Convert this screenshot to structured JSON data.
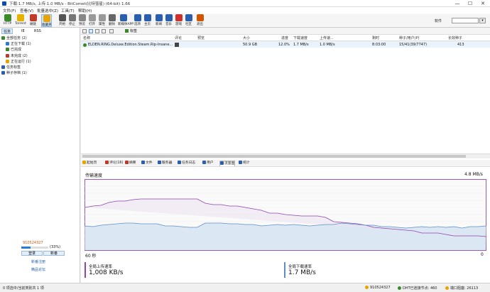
{
  "window": {
    "title": "下载:1.7 MB/s, 上传:1.0 MB/s - BitComet(比特彗星) (64-bit) 1.66",
    "controls": [
      "—",
      "☐",
      "✕"
    ]
  },
  "menu": [
    "文件(F)",
    "查看(V)",
    "批量选中(Z)",
    "工具(T)",
    "帮助(H)"
  ],
  "toolbar": {
    "buttons": [
      {
        "label": "HTTP",
        "icon": "http-icon",
        "color": "#3a8a2a"
      },
      {
        "label": "Torrent",
        "icon": "torrent-icon",
        "color": "#e5b200"
      },
      {
        "label": "磁链",
        "icon": "magnet-icon",
        "color": "#c0392b"
      },
      {
        "label": "收藏夹",
        "icon": "favorites-icon",
        "color": "#e8a400"
      },
      {
        "label": "开始",
        "icon": "start-icon",
        "color": "#555"
      },
      {
        "label": "停止",
        "icon": "stop-icon",
        "color": "#777"
      },
      {
        "label": "预览",
        "icon": "preview-icon",
        "color": "#888"
      },
      {
        "label": "打开",
        "icon": "open-icon",
        "color": "#999"
      },
      {
        "label": "属性",
        "icon": "properties-icon",
        "color": "#999"
      },
      {
        "label": "删除",
        "icon": "delete-icon",
        "color": "#666"
      },
      {
        "label": "新媒体APP",
        "icon": "app-icon",
        "color": "#2a5fb0"
      },
      {
        "label": "选项",
        "icon": "options-icon",
        "color": "#2a5fb0"
      },
      {
        "label": "主页",
        "icon": "home-icon",
        "color": "#2a5fb0"
      },
      {
        "label": "新闻",
        "icon": "news-icon",
        "color": "#2a5fb0"
      },
      {
        "label": "音乐",
        "icon": "music-icon",
        "color": "#2a5fb0"
      },
      {
        "label": "游戏",
        "icon": "game-icon",
        "color": "#d0312d"
      },
      {
        "label": "社区",
        "icon": "community-icon",
        "color": "#2a5fb0"
      },
      {
        "label": "退出",
        "icon": "exit-icon",
        "color": "#d35400"
      }
    ],
    "search_label": "软件",
    "search_value": ""
  },
  "sidebar": {
    "tabs": [
      "任务",
      "IE",
      "RSS"
    ],
    "tree": [
      {
        "label": "全部任务 (2)",
        "indent": 0,
        "color": "#3a8a2a"
      },
      {
        "label": "正在下载 (1)",
        "indent": 1,
        "color": "#2a7ad8"
      },
      {
        "label": "已完成",
        "indent": 1,
        "color": "#3a8a2a"
      },
      {
        "label": "未完成 (2)",
        "indent": 1,
        "color": "#c0392b"
      },
      {
        "label": "正在运行 (1)",
        "indent": 1,
        "color": "#e8a400"
      },
      {
        "label": "任务标签",
        "indent": 0,
        "color": "#2a5fb0"
      },
      {
        "label": "种子存档 (1)",
        "indent": 0,
        "color": "#2a5fb0"
      }
    ],
    "ad": {
      "number": "910524327",
      "level": "(33%)",
      "login": "登录",
      "register": "新番",
      "link1": "新番注册",
      "link2": "精品论坛"
    }
  },
  "tasklist": {
    "tools": [
      "标签"
    ],
    "columns": [
      "名称",
      "评论",
      "预览",
      "大小",
      "进度",
      "下载速度",
      "上传速...",
      "剩时",
      "种子/用户(P)",
      "长效种子"
    ],
    "rows": [
      {
        "name": "ELDEN.RING.Deluxe.Edition.Steam.Rip-Insane...",
        "comment": "",
        "preview": "",
        "size": "50.9 GB",
        "progress": "12.0%",
        "down": "1.7 MB/s",
        "up": "1.0 MB/s",
        "eta": "8:03:00",
        "seeds": "15/41(39/7747)",
        "longseed": "413"
      }
    ]
  },
  "detail_tabs": [
    "起始页",
    "评论(16)",
    "摘要",
    "文件",
    "服务器",
    "任务日志",
    "用户",
    "流量图",
    "统计"
  ],
  "graph": {
    "title": "传输速度",
    "max_label": "4.8 MB/s",
    "left_label": "60 秒",
    "right_label": "0",
    "upload_legend_label": "全局上传速率",
    "upload_legend_value": "1,008 KB/s",
    "download_legend_label": "全局下载速率",
    "download_legend_value": "1.7 MB/s",
    "upload_color": "#8e44ad",
    "download_color": "#5a8fc8",
    "upload_fraction": [
      0.6,
      0.62,
      0.63,
      0.67,
      0.69,
      0.69,
      0.71,
      0.72,
      0.72,
      0.72,
      0.72,
      0.72,
      0.72,
      0.72,
      0.72,
      0.66,
      0.64,
      0.64,
      0.62,
      0.62,
      0.6,
      0.58,
      0.56,
      0.52,
      0.52,
      0.5,
      0.49,
      0.48,
      0.48,
      0.48,
      0.46,
      0.4,
      0.39,
      0.38,
      0.37,
      0.35,
      0.32,
      0.31,
      0.3,
      0.29,
      0.28,
      0.27,
      0.24,
      0.24,
      0.24,
      0.22,
      0.2,
      0.2,
      0.2,
      0.2,
      0.19
    ],
    "download_fraction": [
      0.34,
      0.33,
      0.35,
      0.36,
      0.37,
      0.38,
      0.38,
      0.37,
      0.37,
      0.37,
      0.34,
      0.34,
      0.33,
      0.32,
      0.32,
      0.38,
      0.38,
      0.38,
      0.37,
      0.37,
      0.36,
      0.36,
      0.34,
      0.35,
      0.36,
      0.35,
      0.36,
      0.35,
      0.34,
      0.35,
      0.36,
      0.36,
      0.38,
      0.37,
      0.36,
      0.35,
      0.35,
      0.33,
      0.33,
      0.32,
      0.31,
      0.32,
      0.33,
      0.32,
      0.33,
      0.32,
      0.33,
      0.31,
      0.33,
      0.33,
      0.34
    ]
  },
  "status": {
    "left": "0 项选中/当前类别共 1 项",
    "number": "910524327",
    "dht": "DHT已连接节点: 460",
    "port": "端口阻塞: 26113"
  }
}
